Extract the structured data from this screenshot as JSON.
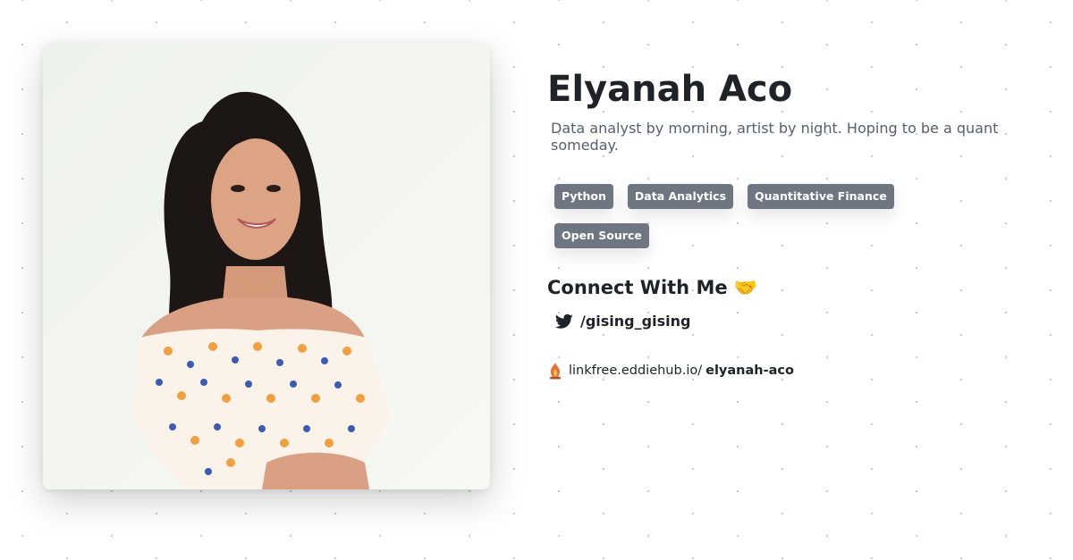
{
  "profile": {
    "name": "Elyanah Aco",
    "bio": "Data analyst by morning, artist by night. Hoping to be a quant someday.",
    "photo_alt": "Elyanah Aco"
  },
  "tags": [
    "Python",
    "Data Analytics",
    "Quantitative Finance",
    "Open Source"
  ],
  "connect": {
    "heading": "Connect With Me 🤝",
    "social": [
      {
        "icon": "twitter-icon",
        "handle": "/gising_gising"
      }
    ]
  },
  "footer": {
    "icon": "linkfree-logo-icon",
    "domain": "linkfree.eddiehub.io/",
    "username": "elyanah-aco"
  },
  "colors": {
    "tag_background": "#6e7781",
    "tag_text": "#ffffff",
    "text_primary": "#1f2328",
    "text_secondary": "#57606a"
  }
}
